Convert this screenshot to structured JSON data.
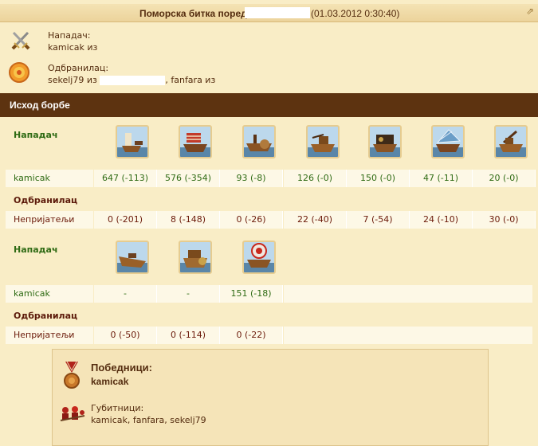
{
  "header": {
    "title": "Поморска битка поред",
    "date": "(01.03.2012 0:30:40)",
    "corner": "⇗"
  },
  "participants": {
    "attacker_label": "Нападач:",
    "attacker_name": "kamicak из",
    "defender_label": "Одбранилац:",
    "defender_name": "sekelj79 из",
    "defender_extra": ", fanfara из"
  },
  "result_title": "Исход борбе",
  "round1": {
    "attacker_label": "Нападач",
    "defender_label": "Одбранилац",
    "attacker_name": "kamicak",
    "defender_name": "Непријатељи",
    "units": [
      "ram-ship-icon",
      "fire-ship-icon",
      "paddle-ship-icon",
      "ballista-ship-icon",
      "catapult-ship-icon",
      "steam-ship-icon",
      "mortar-ship-icon"
    ],
    "attacker_values": [
      "647 (-113)",
      "576 (-354)",
      "93 (-8)",
      "126 (-0)",
      "150 (-0)",
      "47 (-11)",
      "20 (-0)"
    ],
    "defender_values": [
      "0 (-201)",
      "8 (-148)",
      "0 (-26)",
      "22 (-40)",
      "7 (-54)",
      "24 (-10)",
      "30 (-0)"
    ]
  },
  "round2": {
    "attacker_label": "Нападач",
    "defender_label": "Одбранилац",
    "attacker_name": "kamicak",
    "defender_name": "Непријатељи",
    "units": [
      "diving-boat-icon",
      "paddle-speedboat-icon",
      "balloon-carrier-icon"
    ],
    "attacker_values": [
      "-",
      "-",
      "151 (-18)"
    ],
    "defender_values": [
      "0 (-50)",
      "0 (-114)",
      "0 (-22)"
    ]
  },
  "outcome": {
    "winners_label": "Победници:",
    "winners": "kamicak",
    "losers_label": "Губитници:",
    "losers": "kamicak, fanfara, sekelj79"
  },
  "colors": {
    "result_bar": "#5d3310",
    "attacker_text": "#2f6b14",
    "defender_text": "#6b1a0a",
    "background": "#f9edc6"
  }
}
